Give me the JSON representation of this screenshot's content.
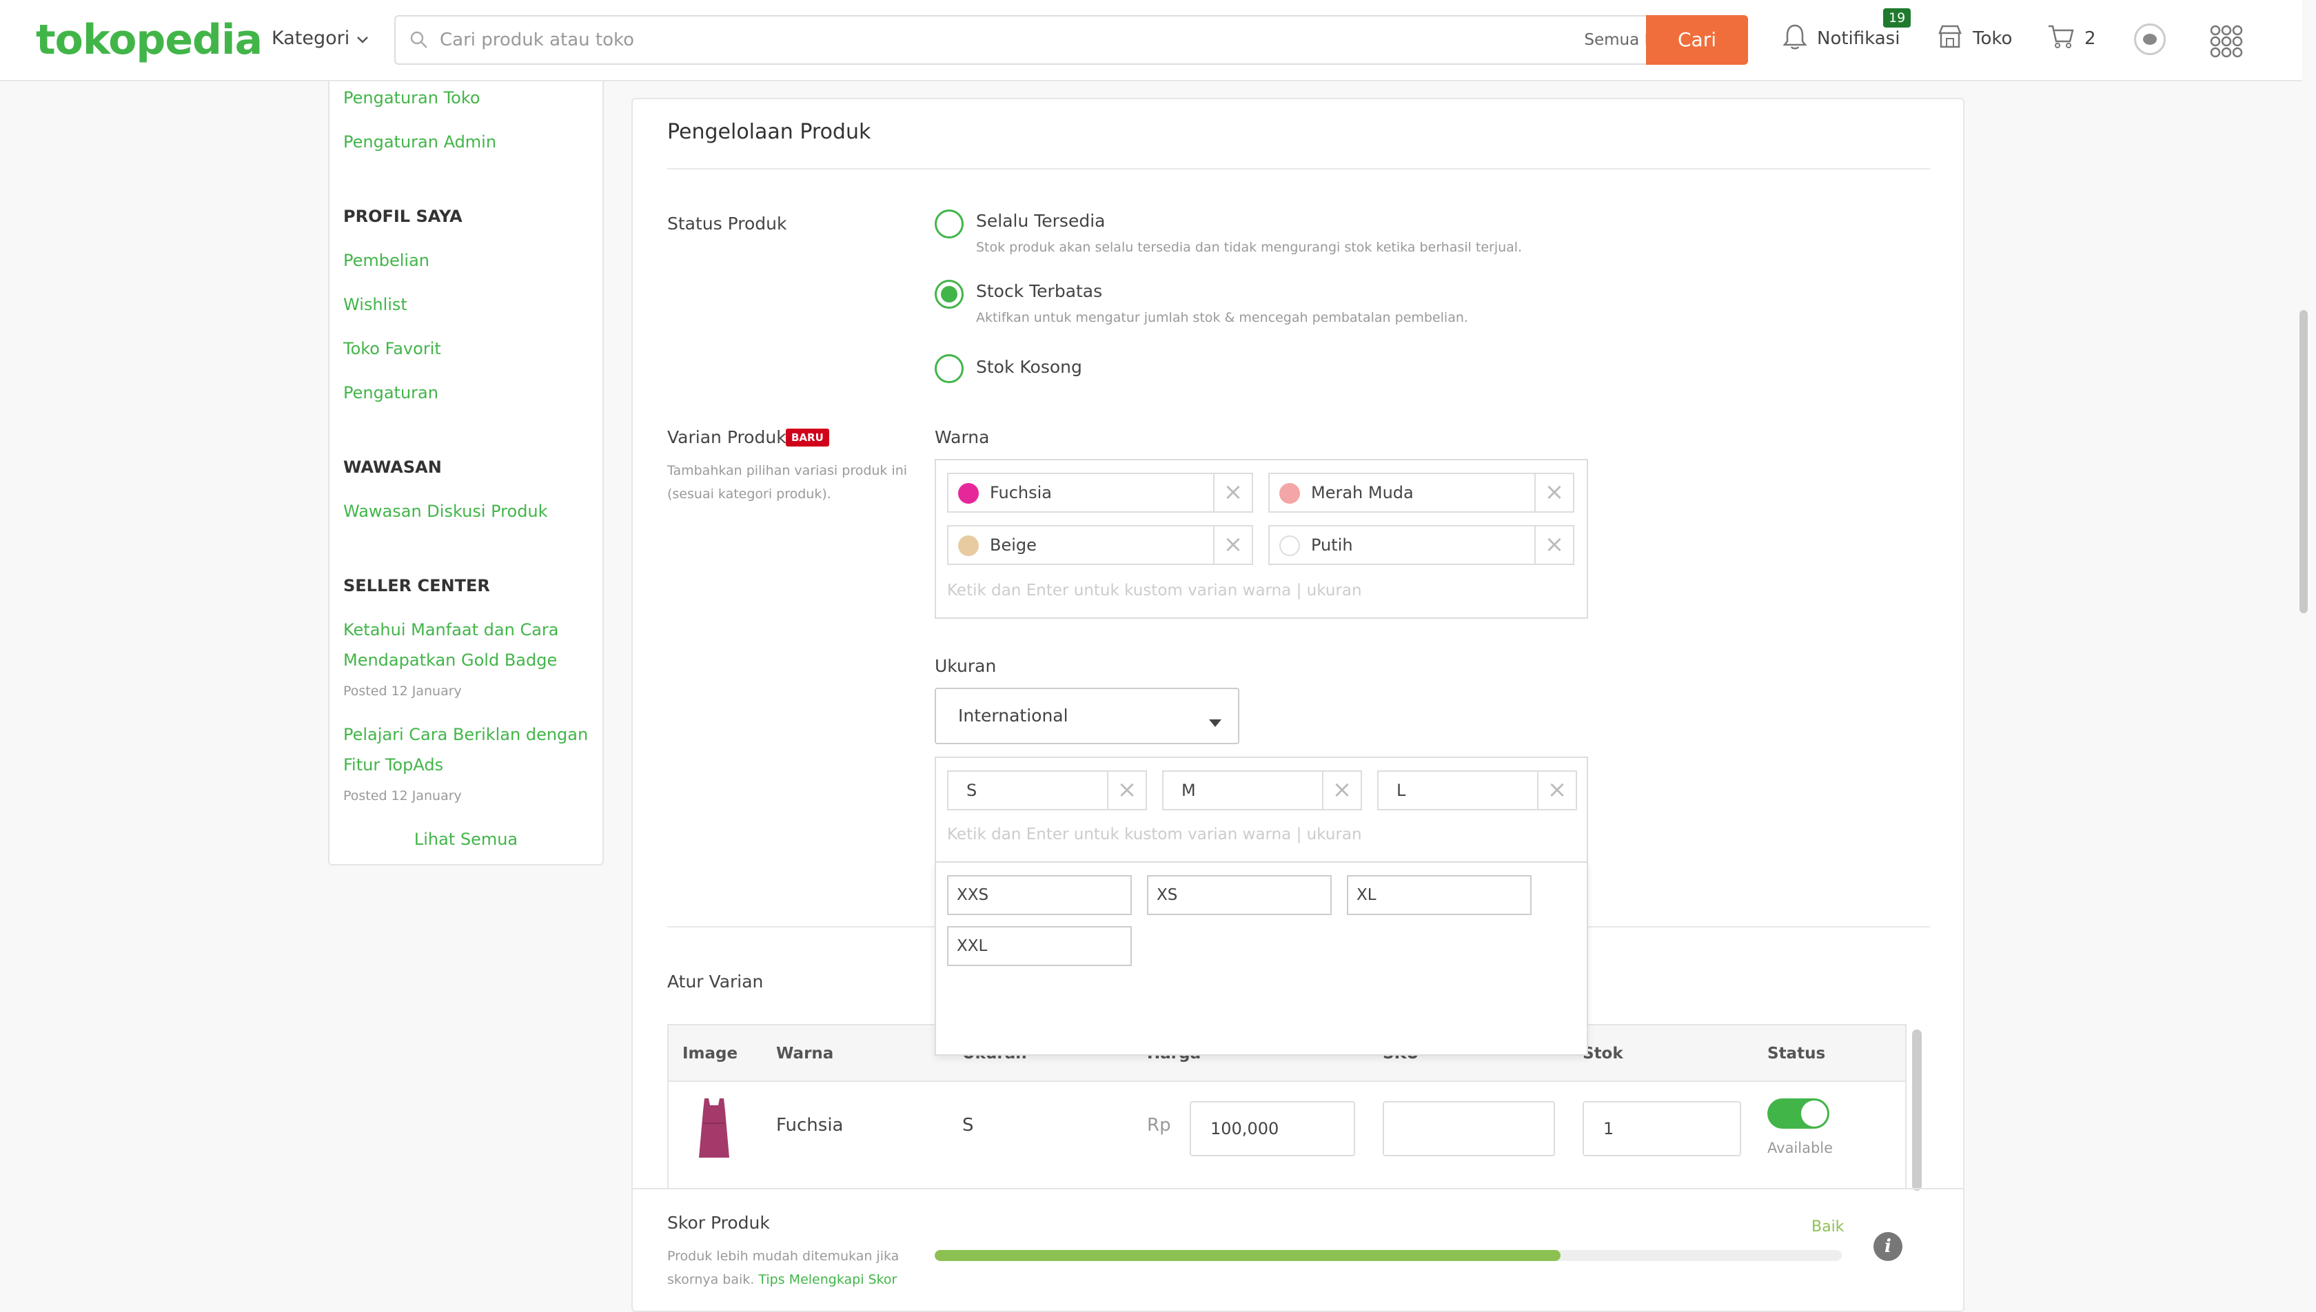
{
  "header": {
    "logo": "tokopedia",
    "kategori_label": "Kategori",
    "search_placeholder": "Cari produk atau toko",
    "search_category": "Semua Kategori",
    "search_button": "Cari",
    "notif_label": "Notifikasi",
    "notif_count": "19",
    "toko_label": "Toko",
    "cart_count": "2"
  },
  "sidebar": {
    "links_top": [
      "Pengaturan Toko",
      "Pengaturan Admin"
    ],
    "profil_head": "PROFIL SAYA",
    "profil_links": [
      "Pembelian",
      "Wishlist",
      "Toko Favorit",
      "Pengaturan"
    ],
    "wawasan_head": "WAWASAN",
    "wawasan_links": [
      "Wawasan Diskusi Produk"
    ],
    "seller_head": "SELLER CENTER",
    "seller_posts": [
      {
        "line1": "Ketahui Manfaat dan Cara",
        "line2": "Mendapatkan Gold Badge",
        "date": "Posted 12 January"
      },
      {
        "line1": "Pelajari Cara Beriklan dengan",
        "line2": "Fitur TopAds",
        "date": "Posted 12 January"
      }
    ],
    "see_all": "Lihat Semua"
  },
  "main": {
    "title": "Pengelolaan Produk",
    "status_label": "Status Produk",
    "status_options": [
      {
        "title": "Selalu Tersedia",
        "help": "Stok produk akan selalu tersedia dan tidak mengurangi stok ketika berhasil terjual.",
        "selected": false
      },
      {
        "title": "Stock Terbatas",
        "help": "Aktifkan untuk mengatur jumlah stok & mencegah pembatalan pembelian.",
        "selected": true
      },
      {
        "title": "Stok Kosong",
        "help": "",
        "selected": false
      }
    ],
    "varian_label": "Varian Produk",
    "baru_badge": "BARU",
    "varian_help_1": "Tambahkan pilihan variasi produk ini",
    "varian_help_2": "(sesuai kategori produk).",
    "warna_label": "Warna",
    "warna_chips": [
      {
        "label": "Fuchsia",
        "color": "#e5279a"
      },
      {
        "label": "Merah Muda",
        "color": "#f4a6a6"
      },
      {
        "label": "Beige",
        "color": "#e8cba0"
      },
      {
        "label": "Putih",
        "color": "#ffffff"
      }
    ],
    "custom_placeholder": "Ketik dan Enter untuk kustom varian warna | ukuran",
    "ukuran_label": "Ukuran",
    "ukuran_select": "International",
    "ukuran_chips": [
      "S",
      "M",
      "L"
    ],
    "ukuran_options": [
      "XXS",
      "XS",
      "XL",
      "XXL"
    ],
    "atur_varian": "Atur Varian",
    "table_headers": [
      "Image",
      "Warna",
      "Ukuran",
      "Harga",
      "SKU",
      "Stok",
      "Status"
    ],
    "table_row": {
      "warna": "Fuchsia",
      "ukuran": "S",
      "currency": "Rp",
      "harga": "100,000",
      "sku": "",
      "stok": "1",
      "status": "Available"
    },
    "skor_label": "Skor Produk",
    "skor_help_1": "Produk lebih mudah ditemukan jika",
    "skor_help_2": "skornya baik.",
    "skor_tips": "Tips Melengkapi Skor",
    "skor_rating": "Baik",
    "skor_fraction": 0.69
  },
  "colors": {
    "brand": "#42b549",
    "cta": "#ef6e3c",
    "badge_new": "#d0021b"
  }
}
